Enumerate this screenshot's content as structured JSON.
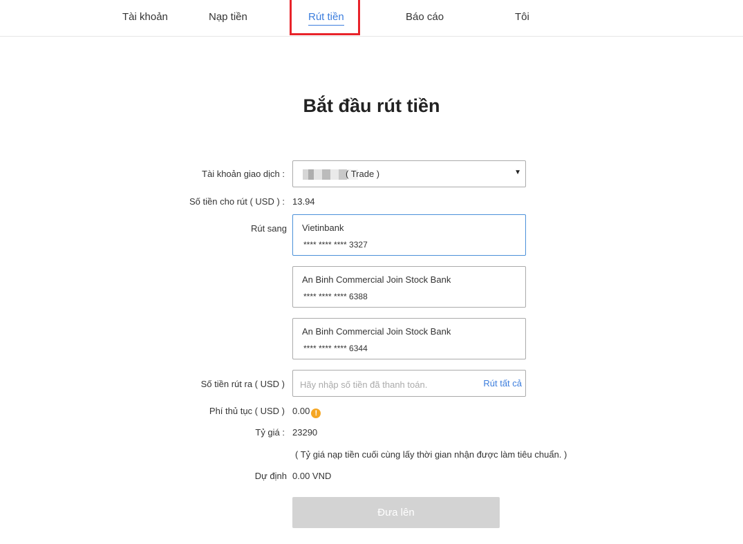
{
  "nav": {
    "items": [
      {
        "label": "Tài khoản"
      },
      {
        "label": "Nạp tiền"
      },
      {
        "label": "Rút tiền"
      },
      {
        "label": "Báo cáo"
      },
      {
        "label": "Tôi"
      }
    ],
    "active": "Rút tiền"
  },
  "page_title": "Bắt đầu rút tiền",
  "form": {
    "account_label": "Tài khoản giao dịch :",
    "account_value": "( Trade )",
    "available_label": "Số tiền cho rút ( USD ) :",
    "available_value": "13.94",
    "withdraw_to_label": "Rút sang",
    "banks": [
      {
        "name": "Vietinbank",
        "number": "**** **** **** 3327",
        "selected": true
      },
      {
        "name": "An Binh Commercial Join Stock Bank",
        "number": "**** **** **** 6388",
        "selected": false
      },
      {
        "name": "An Binh Commercial Join Stock Bank",
        "number": "**** **** **** 6344",
        "selected": false
      }
    ],
    "amount_label": "Số tiền rút ra ( USD )",
    "amount_placeholder": "Hãy nhập số tiền đã thanh toán.",
    "withdraw_all": "Rút tất cả",
    "fee_label": "Phí thủ tục ( USD )",
    "fee_value": "0.00",
    "rate_label": "Tỷ giá :",
    "rate_value": "23290",
    "rate_note": "( Tỷ giá nạp tiền cuối cùng lấy thời gian nhận được làm tiêu chuẩn. )",
    "estimate_label": "Dự định",
    "estimate_value": "0.00 VND",
    "submit_label": "Đưa lên"
  },
  "colors": {
    "accent": "#3b7ddd",
    "highlight": "#e8232a",
    "warning": "#f5a623"
  }
}
